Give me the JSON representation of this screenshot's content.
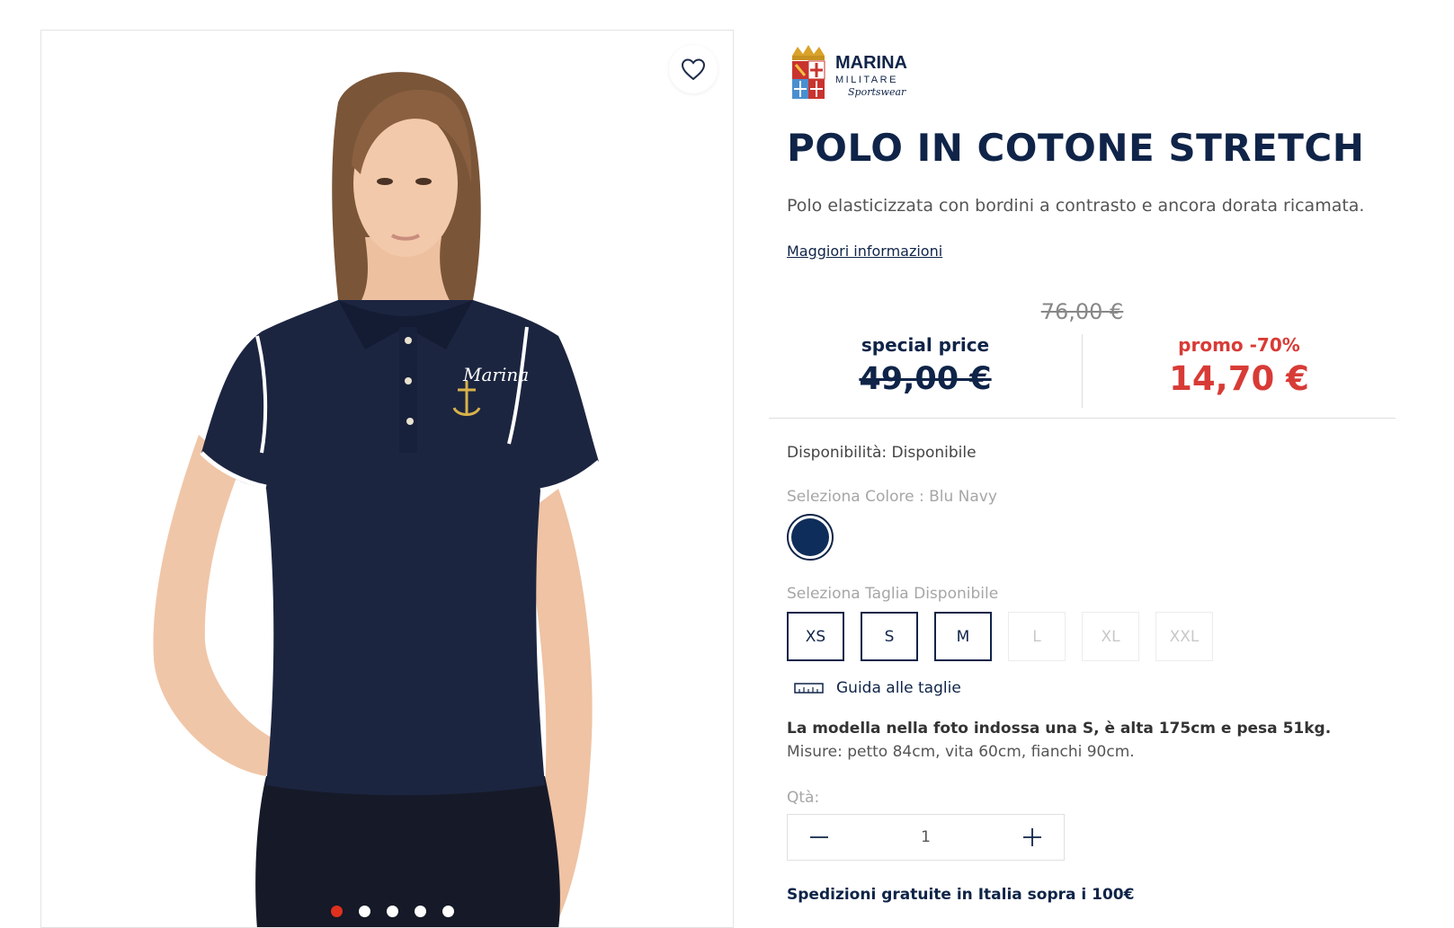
{
  "gallery": {
    "active_slide": 1,
    "slide_count": 5,
    "photo_alt": "Polo in cotone stretch blu navy",
    "wishlist_icon": "heart-icon",
    "embroidery_text": "Marina"
  },
  "brand": {
    "line1": "MARINA",
    "line2": "MILITARE",
    "line3": "Sportswear"
  },
  "product": {
    "title": "POLO IN COTONE STRETCH",
    "description": "Polo elasticizzata con bordini a contrasto e ancora dorata ricamata.",
    "more_info_link": "Maggiori informazioni"
  },
  "pricing": {
    "old_price": "76,00 €",
    "special_label": "special price",
    "special_price": "49,00 €",
    "promo_label": "promo -70%",
    "promo_price": "14,70 €"
  },
  "availability": "Disponibilità: Disponibile",
  "color": {
    "label": "Seleziona Colore : Blu Navy",
    "swatch_hex": "#0f2d5a"
  },
  "size": {
    "label": "Seleziona Taglia Disponibile",
    "options": [
      {
        "label": "XS",
        "available": true
      },
      {
        "label": "S",
        "available": true
      },
      {
        "label": "M",
        "available": true
      },
      {
        "label": "L",
        "available": false
      },
      {
        "label": "XL",
        "available": false
      },
      {
        "label": "XXL",
        "available": false
      }
    ]
  },
  "size_guide": {
    "icon": "ruler-icon",
    "label": "Guida alle taglie"
  },
  "model_info": {
    "line1": "La modella nella foto indossa una S, è alta 175cm e pesa 51kg.",
    "line2": "Misure: petto 84cm, vita 60cm, fianchi 90cm."
  },
  "quantity": {
    "label": "Qtà:",
    "value": "1",
    "minus_icon": "minus-icon",
    "plus_icon": "plus-icon"
  },
  "shipping_note": "Spedizioni gratuite in Italia sopra i 100€",
  "colors": {
    "navy": "#0f2448",
    "promo_red": "#d83b36",
    "dot_active": "#e0301e"
  }
}
